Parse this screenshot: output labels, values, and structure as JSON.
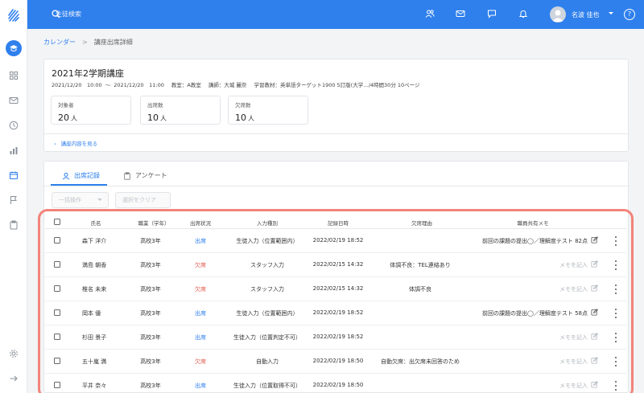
{
  "topbar": {
    "search_placeholder": "生徒検索",
    "user_name": "名波 佳也",
    "help_label": "?"
  },
  "breadcrumb": {
    "parent": "カレンダー",
    "separator": ">",
    "current": "講座出席詳細"
  },
  "course": {
    "title": "2021年2学期講座",
    "start": "2021/12/20　10:00",
    "tilde": "〜",
    "end": "2021/12/20　11:00",
    "classroom": "教室：A教室",
    "teacher": "講師：大城 麗奈",
    "material": "学習教材：英単語ターゲット1900 5訂版(大学…/4時間30分 10ページ",
    "stats": [
      {
        "label": "対象者",
        "value": "20",
        "unit": "人"
      },
      {
        "label": "出席数",
        "value": "10",
        "unit": "人"
      },
      {
        "label": "欠席数",
        "value": "10",
        "unit": "人"
      }
    ],
    "show_more": "講座内容を見る"
  },
  "tabs": {
    "attendance": "出席記録",
    "survey": "アンケート"
  },
  "toolbar": {
    "bulk_action": "一括操作",
    "clear_selection": "選択をクリア"
  },
  "table": {
    "headers": {
      "name": "氏名",
      "grade": "職業（学年）",
      "status": "出席状況",
      "input_type": "入力種別",
      "record_time": "記録日時",
      "absence_reason": "欠席理由",
      "memo": "職員共有メモ"
    },
    "rows": [
      {
        "name": "森下 洋介",
        "grade": "高校3年",
        "status": "出席",
        "input_type": "生徒入力（位置範囲内）",
        "record_time": "2022/02/19 18:52",
        "absence_reason": "",
        "memo": "前回の課題の提出◯／理解度テスト 82点"
      },
      {
        "name": "満島 朝香",
        "grade": "高校3年",
        "status": "欠席",
        "input_type": "スタッフ入力",
        "record_time": "2022/02/15 14:32",
        "absence_reason": "体調不良：TEL連絡あり",
        "memo": "メモを記入"
      },
      {
        "name": "椎名 未来",
        "grade": "高校3年",
        "status": "欠席",
        "input_type": "スタッフ入力",
        "record_time": "2022/02/15 14:32",
        "absence_reason": "体調不良",
        "memo": "メモを記入"
      },
      {
        "name": "岡本 優",
        "grade": "高校3年",
        "status": "出席",
        "input_type": "生徒入力（位置範囲内）",
        "record_time": "2022/02/19 18:52",
        "absence_reason": "",
        "memo": "前回の課題の提出◯／理解度テスト 58点"
      },
      {
        "name": "杉田 景子",
        "grade": "高校3年",
        "status": "出席",
        "input_type": "生徒入力（位置判定不可）",
        "record_time": "2022/02/19 18:52",
        "absence_reason": "",
        "memo": "メモを記入"
      },
      {
        "name": "五十嵐 満",
        "grade": "高校3年",
        "status": "欠席",
        "input_type": "自動入力",
        "record_time": "2022/02/19 18:50",
        "absence_reason": "自動欠席：出欠席未回答のため",
        "memo": "メモを記入"
      },
      {
        "name": "平井 奈々",
        "grade": "高校3年",
        "status": "出席",
        "input_type": "生徒入力（位置取得不可）",
        "record_time": "2022/02/19 18:50",
        "absence_reason": "",
        "memo": "メモを記入"
      }
    ]
  },
  "colors": {
    "primary": "#2f80ed",
    "absent": "#e05a4e",
    "highlight": "#f2837a"
  }
}
